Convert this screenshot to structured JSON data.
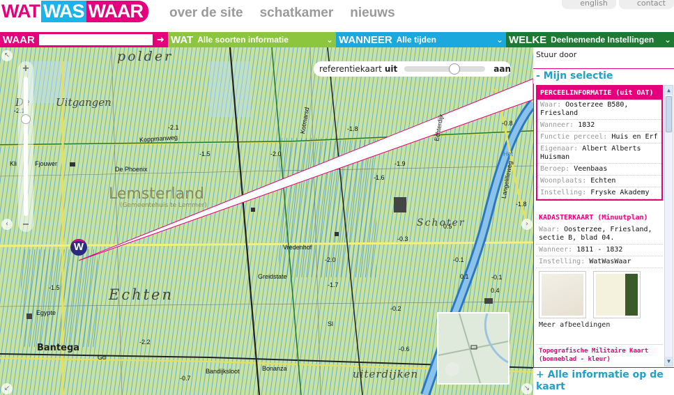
{
  "logo": {
    "part1": "WAT",
    "part2": "WAS",
    "part3": "WAAR"
  },
  "nav": {
    "items": [
      "over de site",
      "schatkamer",
      "nieuws"
    ]
  },
  "top_links": {
    "english": "english",
    "contact": "contact"
  },
  "filters": {
    "waar": {
      "label": "WAAR",
      "value": ""
    },
    "wat": {
      "label": "WAT",
      "value": "Alle soorten informatie"
    },
    "wanneer": {
      "label": "WANNEER",
      "value": "Alle tijden"
    },
    "welke": {
      "label": "WELKE",
      "value": "Deelnemende Instellingen"
    }
  },
  "map": {
    "reference_map": {
      "label": "referentiekaart",
      "off": "uit",
      "on": "aan",
      "level": 0.6
    },
    "labels": {
      "polder": "polder",
      "uitgangen": "Uitgangen",
      "de": "De",
      "lemsterland": "Lemsterland",
      "gemeentehuis": "(Gemeentehuis te Lemmer)",
      "echten": "Echten",
      "schoter": "Schoter",
      "bantega": "Bantega",
      "uiterdijken": "uiterdijken",
      "koppmanweg": "Koppmanweg",
      "de_phoenix": "De Phoenix",
      "fjouwer": "Fjouwer",
      "vredenhof": "Vredenhof",
      "greidstate": "Greidstate",
      "egypte": "Egypte",
      "bonanza": "Bonanza",
      "echterdijk": "Echterdijk",
      "langelilleweg": "Langelilleweg",
      "het_wiel": "Het",
      "kil": "Kli",
      "gd": "Gd",
      "sl": "Sl",
      "kotmarsd": "Kotmarsd",
      "bandijksloot": "Bandijksloot"
    },
    "depths": [
      "-2.1",
      "-1.5",
      "-2.0",
      "-1.9",
      "-1.8",
      "-1.6",
      "-0.8",
      "-1.7",
      "-2.2",
      "-0.6",
      "-0.7",
      "-0.1",
      "0.1",
      "0.4",
      "-1.5",
      "-0.2",
      "-2.1",
      "-0.3",
      "-0.1",
      "-1.8",
      "-2.0",
      "0.5"
    ],
    "marker_letter": "W"
  },
  "panel": {
    "stuur_door": "Stuur door",
    "mijn_selectie": "- Mijn selectie",
    "card1": {
      "title": "PERCEELINFORMATIE (uit OAT)",
      "rows": [
        {
          "k": "Waar:",
          "v": "Oosterzee B580, Friesland"
        },
        {
          "k": "Wanneer:",
          "v": "1832"
        },
        {
          "k": "Functie perceel:",
          "v": "Huis en Erf"
        },
        {
          "k": "Eigenaar:",
          "v": "Albert Alberts Huisman"
        },
        {
          "k": "Beroep:",
          "v": "Veenbaas"
        },
        {
          "k": "Woonplaats:",
          "v": "Echten"
        },
        {
          "k": "Instelling:",
          "v": "Fryske Akademy"
        }
      ]
    },
    "card2": {
      "title": "KADASTERKAART (Minuutplan)",
      "rows": [
        {
          "k": "Waar:",
          "v": "Oosterzee, Friesland, sectie B, blad 04."
        },
        {
          "k": "Wanneer:",
          "v": "1811 - 1832"
        },
        {
          "k": "Instelling:",
          "v": "WatWasWaar"
        }
      ],
      "more": "Meer afbeeldingen"
    },
    "card3": {
      "title": "Topografische Militaire Kaart (bonneblad - kleur)"
    },
    "alle_info": "+ Alle informatie op de kaart"
  },
  "colors": {
    "pink": "#e4007c",
    "green": "#8cc63f",
    "blue": "#1ba8dd",
    "darkgreen": "#1e7a32",
    "teal": "#22a0c8"
  }
}
